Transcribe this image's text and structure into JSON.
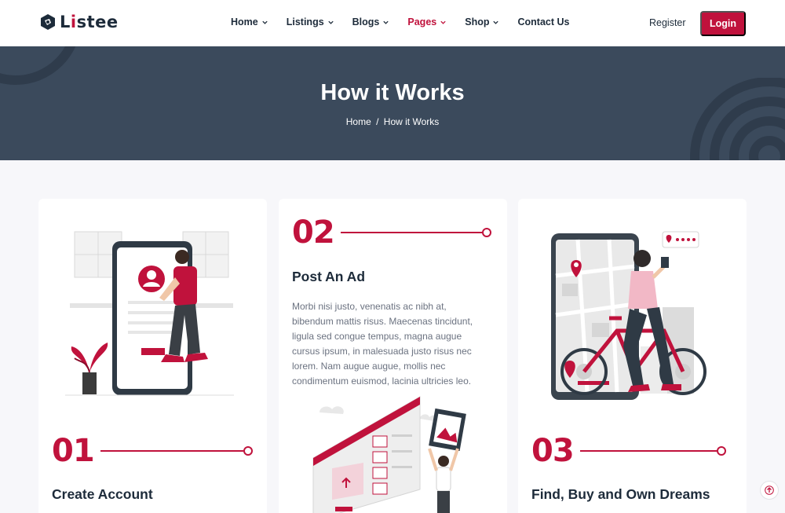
{
  "brand": {
    "logo_text_pre": "L",
    "logo_text_i": "i",
    "logo_text_post": "stee"
  },
  "nav": {
    "items": [
      {
        "label": "Home",
        "has_dropdown": true
      },
      {
        "label": "Listings",
        "has_dropdown": true
      },
      {
        "label": "Blogs",
        "has_dropdown": true
      },
      {
        "label": "Pages",
        "has_dropdown": true,
        "active": true
      },
      {
        "label": "Shop",
        "has_dropdown": true
      },
      {
        "label": "Contact Us",
        "has_dropdown": false
      }
    ],
    "register_label": "Register",
    "login_label": "Login"
  },
  "hero": {
    "title": "How it Works",
    "breadcrumb": {
      "home": "Home",
      "separator": "/",
      "current": "How it Works"
    }
  },
  "steps": [
    {
      "number": "01",
      "title": "Create Account",
      "illustration": "signup-phone-illustration"
    },
    {
      "number": "02",
      "title": "Post An Ad",
      "text": "Morbi nisi justo, venenatis ac nibh at, bibendum mattis risus. Maecenas tincidunt, ligula sed congue tempus, magna augue cursus ipsum, in malesuada justo risus nec lorem. Nam augue augue, mollis nec condimentum euismod, lacinia ultricies leo.",
      "illustration": "upload-ad-illustration"
    },
    {
      "number": "03",
      "title": "Find, Buy and Own Dreams",
      "illustration": "map-bicycle-illustration"
    }
  ],
  "colors": {
    "accent": "#c0123c",
    "hero_bg": "#3b4a5c",
    "text_dark": "#1d2b3a"
  },
  "icons": {
    "scroll_top": "arrow-up-icon",
    "dropdown": "chevron-down-icon"
  }
}
